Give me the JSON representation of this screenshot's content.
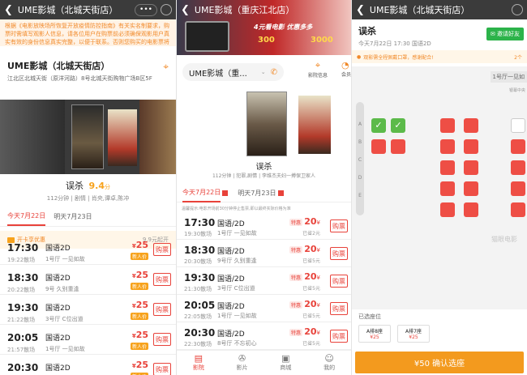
{
  "p1": {
    "title": "UME影城（北城天街店）",
    "notice": "根据《电影放映场所恢复开放疫情防控指南》有关实名制要求，购票时需填写观影人信息，请各位用户在购票前必须确保观影用户真实有效的身份信息真实完整，以便于联系。否则您购买的电影票将无法完成观影，感谢您的配合。",
    "cinema_name": "UME影城（北城天街店）",
    "address": "江北区北城天街（原洋河路）8号北城天街购物广场B区5F",
    "movie_title": "误杀",
    "rating": "9.4",
    "rating_unit": "分",
    "movie_info": "112分钟 | 剧情 | 肖央,谭卓,陈冲",
    "date_today": "今天7月22日",
    "date_tomorrow": "明天7月23日",
    "promo_label": "开卡享优惠",
    "promo_right": "9.9元起开",
    "showtimes": [
      {
        "time": "17:30",
        "end": "19:22散场",
        "type": "国语2D",
        "hall": "1号厅 一见如故",
        "price": "25",
        "tag": "新人价"
      },
      {
        "time": "18:30",
        "end": "20:22散场",
        "type": "国语2D",
        "hall": "9号 久别重逢",
        "price": "25",
        "tag": "新人价"
      },
      {
        "time": "19:30",
        "end": "21:22散场",
        "type": "国语2D",
        "hall": "3号厅 C位出道",
        "price": "25",
        "tag": "新人价"
      },
      {
        "time": "20:05",
        "end": "21:57散场",
        "type": "国语2D",
        "hall": "1号厅 一见如故",
        "price": "25",
        "tag": "新人价"
      },
      {
        "time": "20:30",
        "end": "22:22散场",
        "type": "国语2D",
        "hall": "8号厅 不忘初心",
        "price": "25",
        "tag": "新人价"
      }
    ],
    "buy_label": "购票",
    "price_prefix": "¥"
  },
  "p2": {
    "title": "UME影城（重庆江北店）",
    "banner_text": "4元看电影 优惠多多",
    "banner_amount1": "300",
    "banner_amount2": "3000",
    "cinema_select": "UME影城（重...",
    "nav_info": "影院信息",
    "nav_more": "会员",
    "movie_title": "误杀",
    "movie_info": "112分钟 | 犯罪,剧情 | 李维杰夫妇一搏保卫家人",
    "date_today": "今天7月22日",
    "date_tomorrow": "明天7月23日",
    "hint": "温馨提示:电影开场前30分钟停止售票,即以最终实际价格为准",
    "showtimes": [
      {
        "time": "17:30",
        "end": "19:30散场",
        "type": "国语/2D",
        "hall": "1号厅 一见如故",
        "price": "20",
        "save": "已省2元"
      },
      {
        "time": "18:30",
        "end": "20:30散场",
        "type": "国语/2D",
        "hall": "9号厅 久别重逢",
        "price": "20",
        "save": "已省5元"
      },
      {
        "time": "19:30",
        "end": "21:30散场",
        "type": "国语/2D",
        "hall": "3号厅 C位出道",
        "price": "20",
        "save": "已省5元"
      },
      {
        "time": "20:05",
        "end": "22:05散场",
        "type": "国语/2D",
        "hall": "1号厅 一见如故",
        "price": "20",
        "save": "已省5元"
      },
      {
        "time": "20:30",
        "end": "22:30散场",
        "type": "国语/2D",
        "hall": "8号厅 不忘初心",
        "price": "20",
        "save": "已省5元"
      }
    ],
    "special_label": "特惠",
    "yen": "¥",
    "buy_label": "购票",
    "tabs": [
      "影院",
      "影片",
      "商城",
      "我的"
    ]
  },
  "p3": {
    "title": "UME影城（北城天街店）",
    "movie_title": "误杀",
    "invite_label": "邀请好友",
    "movie_sub": "今天7月22日 17:30 国语2D",
    "mask_notice": "观影需全程佩戴口罩，感谢配合!",
    "mask_right": "2个",
    "hall_label": "1号厅一见如",
    "screen_center": "银幕中央",
    "row_letters": [
      "A",
      "B",
      "C",
      "D",
      "E"
    ],
    "watermark": "猫眼电影",
    "selected_label": "已选座位",
    "selected": [
      {
        "seat": "A排8座",
        "price": "¥25"
      },
      {
        "seat": "A排7座",
        "price": "¥25"
      }
    ],
    "confirm_label": "¥50 确认选座"
  },
  "colors": {
    "accent": "#e8423a",
    "orange": "#f7a21b",
    "green": "#5cba4a",
    "topbar": "#3b3b3b"
  }
}
